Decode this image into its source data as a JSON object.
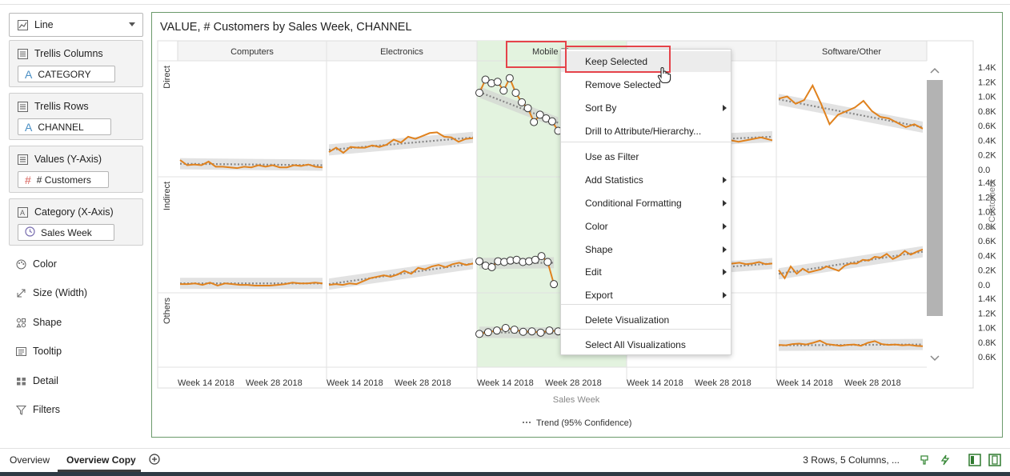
{
  "viz_type": "Line",
  "panel": {
    "sections": [
      {
        "header": "Trellis Columns",
        "item": "CATEGORY",
        "item_icon": "attribute-icon"
      },
      {
        "header": "Trellis Rows",
        "item": "CHANNEL",
        "item_icon": "attribute-icon"
      },
      {
        "header": "Values (Y-Axis)",
        "item": "# Customers",
        "item_icon": "measure-icon"
      },
      {
        "header": "Category (X-Axis)",
        "item": "Sales Week",
        "item_icon": "clock-icon"
      }
    ],
    "properties": [
      "Color",
      "Size (Width)",
      "Shape",
      "Tooltip",
      "Detail",
      "Filters"
    ]
  },
  "visualization": {
    "title": "VALUE, # Customers by Sales Week, CHANNEL",
    "x_axis_title": "Sales Week",
    "y_axis_title": "# Customers",
    "legend": "Trend (95% Confidence)",
    "accent_color": "#e0821e",
    "selected_column_bg": "#e3f3df"
  },
  "chart_data": {
    "type": "line",
    "trellis_columns": [
      "Computers",
      "Electronics",
      "Mobile Ph",
      "",
      "Software/Other"
    ],
    "trellis_rows": [
      "Direct",
      "Indirect",
      "Others"
    ],
    "x_tick_labels": [
      "Week 14 2018",
      "Week 28 2018"
    ],
    "y_ticks": [
      "1.4K",
      "1.2K",
      "1.0K",
      "0.8K",
      "0.6K",
      "0.4K",
      "0.2K",
      "0.0"
    ],
    "y_ticks_partial": [
      "1.4K",
      "1.2K",
      "1.0K",
      "0.8K",
      "0.6K"
    ],
    "ylim": [
      0,
      1400
    ],
    "panels": [
      {
        "row": "Direct",
        "column": "Computers",
        "values": [
          130,
          60,
          70,
          60,
          110,
          40,
          40,
          30,
          20,
          40,
          30,
          60,
          40,
          60,
          30,
          30,
          60,
          50,
          70,
          40,
          30
        ],
        "trend": [
          80,
          60
        ]
      },
      {
        "row": "Direct",
        "column": "Electronics",
        "values": [
          240,
          300,
          230,
          310,
          300,
          300,
          330,
          310,
          340,
          410,
          370,
          450,
          420,
          460,
          500,
          510,
          450,
          440,
          380,
          420,
          430
        ],
        "trend": [
          270,
          440
        ]
      },
      {
        "row": "Direct",
        "column": "Mobile Ph",
        "values": [
          1050,
          1230,
          1180,
          1200,
          1080,
          1250,
          1050,
          920,
          840,
          650,
          750,
          700,
          660,
          530
        ],
        "trend": [
          1060,
          640
        ],
        "markers": true
      },
      {
        "row": "Direct",
        "column": "",
        "values": [
          470,
          400,
          440,
          410,
          380,
          410,
          440,
          400
        ],
        "trend": [
          400,
          450
        ]
      },
      {
        "row": "Direct",
        "column": "Software/Other",
        "values": [
          970,
          1000,
          900,
          950,
          1150,
          900,
          620,
          750,
          800,
          850,
          940,
          800,
          720,
          700,
          640,
          580,
          620,
          560
        ],
        "trend": [
          960,
          580
        ]
      },
      {
        "row": "Indirect",
        "column": "Computers",
        "values": [
          20,
          20,
          30,
          10,
          40,
          0,
          30,
          20,
          10,
          10,
          0,
          0,
          0,
          10,
          20,
          40,
          30,
          30,
          40,
          30
        ],
        "trend": [
          30,
          30
        ]
      },
      {
        "row": "Indirect",
        "column": "Electronics",
        "values": [
          10,
          20,
          10,
          30,
          20,
          60,
          100,
          120,
          140,
          120,
          150,
          200,
          160,
          240,
          220,
          260,
          280,
          250,
          290,
          310,
          280,
          300
        ],
        "trend": [
          20,
          300
        ]
      },
      {
        "row": "Indirect",
        "column": "Mobile Ph",
        "values": [
          330,
          270,
          250,
          330,
          320,
          340,
          350,
          320,
          330,
          350,
          400,
          320,
          20
        ],
        "trend": [
          300,
          310
        ],
        "markers": true
      },
      {
        "row": "Indirect",
        "column": "",
        "values": [
          190,
          250,
          220,
          260,
          250,
          290,
          300,
          310,
          290,
          300,
          320,
          290,
          300
        ],
        "trend": [
          220,
          300
        ]
      },
      {
        "row": "Indirect",
        "column": "Software/Other",
        "values": [
          210,
          100,
          260,
          160,
          230,
          180,
          200,
          220,
          260,
          230,
          200,
          270,
          300,
          300,
          350,
          340,
          390,
          380,
          430,
          360,
          400,
          470,
          420,
          460,
          490
        ],
        "trend": [
          160,
          460
        ]
      },
      {
        "row": "Others",
        "column": "Mobile Ph",
        "values": [
          560,
          600,
          640,
          700,
          660,
          610,
          620,
          590,
          640,
          620
        ],
        "trend": [
          600,
          580
        ],
        "markers": true
      },
      {
        "row": "Others",
        "column": "Software/Other",
        "values": [
          300,
          290,
          320,
          330,
          310,
          350,
          400,
          320,
          300,
          280,
          300,
          310,
          280,
          350,
          390,
          320,
          300,
          310,
          290,
          300,
          280,
          270
        ],
        "trend": [
          290,
          310
        ]
      }
    ]
  },
  "context_menu": {
    "items": [
      {
        "label": "Keep Selected",
        "submenu": false,
        "highlighted": true
      },
      {
        "label": "Remove Selected",
        "submenu": false
      },
      {
        "label": "Sort By",
        "submenu": true
      },
      {
        "label": "Drill to Attribute/Hierarchy...",
        "submenu": false
      },
      {
        "label": "Use as Filter",
        "submenu": false
      },
      {
        "label": "Add Statistics",
        "submenu": true
      },
      {
        "label": "Conditional Formatting",
        "submenu": true
      },
      {
        "label": "Color",
        "submenu": true
      },
      {
        "label": "Shape",
        "submenu": true
      },
      {
        "label": "Edit",
        "submenu": true
      },
      {
        "label": "Export",
        "submenu": true
      },
      {
        "label": "Delete Visualization",
        "submenu": false
      },
      {
        "label": "Select All Visualizations",
        "submenu": false
      }
    ]
  },
  "bottom_bar": {
    "tabs": [
      "Overview",
      "Overview Copy"
    ],
    "active_tab": "Overview Copy",
    "status": "3 Rows, 5 Columns, ..."
  }
}
